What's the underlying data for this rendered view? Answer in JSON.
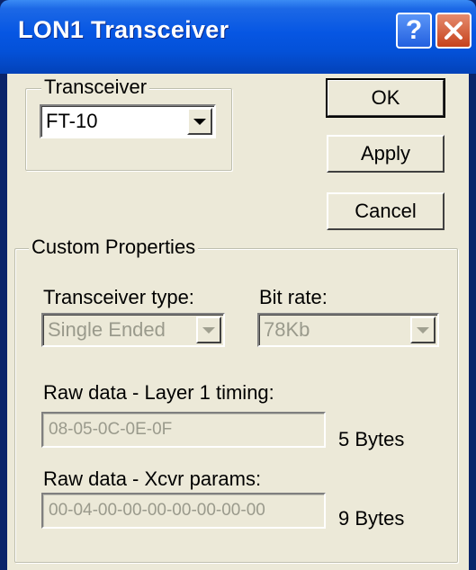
{
  "window": {
    "title": "LON1 Transceiver",
    "help_glyph": "?",
    "close_icon": "close-icon"
  },
  "transceiver_group": {
    "legend": "Transceiver",
    "selected": "FT-10"
  },
  "buttons": {
    "ok": "OK",
    "apply": "Apply",
    "cancel": "Cancel"
  },
  "custom_properties": {
    "legend": "Custom Properties",
    "transceiver_type_label": "Transceiver type:",
    "transceiver_type_value": "Single Ended",
    "bit_rate_label": "Bit rate:",
    "bit_rate_value": "78Kb",
    "layer1_label": "Raw data - Layer 1 timing:",
    "layer1_value": "08-05-0C-0E-0F",
    "layer1_size": "5 Bytes",
    "xcvr_label": "Raw data - Xcvr params:",
    "xcvr_value": "00-04-00-00-00-00-00-00-00",
    "xcvr_size": "9 Bytes"
  },
  "colors": {
    "titlebar": "#0656e3",
    "dialog_bg": "#ece9d8",
    "close_button": "#c6421c",
    "disabled_text": "#9a9a8c"
  }
}
